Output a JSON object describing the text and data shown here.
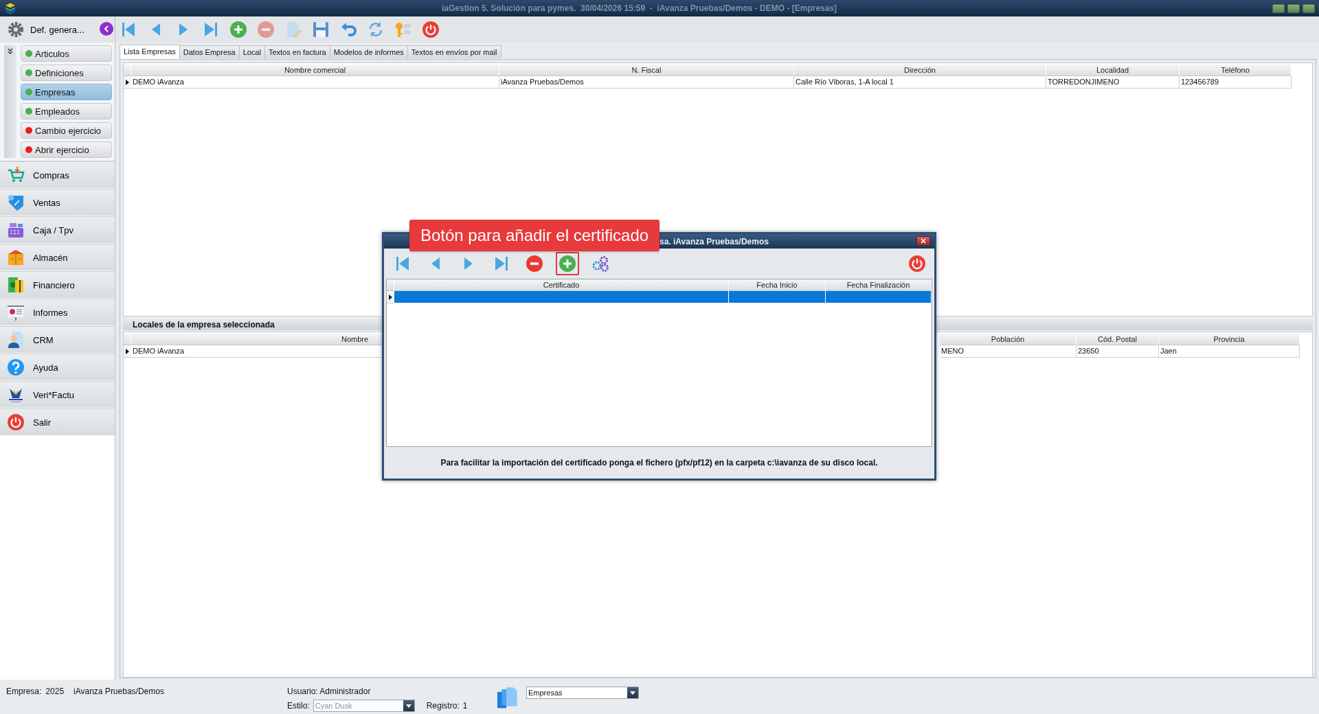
{
  "window": {
    "title": "iaGestion 5. Solución para pymes.  30/04/2026 15:59  -  iAvanza Pruebas/Demos - DEMO - [Empresas]"
  },
  "toolbar": [
    {
      "kind": "first",
      "disabled": false
    },
    {
      "kind": "prev",
      "disabled": false
    },
    {
      "kind": "next",
      "disabled": false
    },
    {
      "kind": "last",
      "disabled": false
    },
    {
      "kind": "add",
      "disabled": false
    },
    {
      "kind": "remove",
      "disabled": true
    },
    {
      "kind": "edit",
      "disabled": true
    },
    {
      "kind": "save",
      "disabled": false
    },
    {
      "kind": "undo",
      "disabled": false
    },
    {
      "kind": "refresh",
      "disabled": false
    },
    {
      "kind": "key",
      "disabled": false
    },
    {
      "kind": "power",
      "disabled": false
    }
  ],
  "sidebar": {
    "header": "Def. genera...",
    "sub_items": [
      {
        "label": "Articulos",
        "color": "#4caf50",
        "selected": false
      },
      {
        "label": "Definiciones",
        "color": "#4caf50",
        "selected": false
      },
      {
        "label": "Empresas",
        "color": "#4caf50",
        "selected": true
      },
      {
        "label": "Empleados",
        "color": "#4caf50",
        "selected": false
      },
      {
        "label": "Cambio ejercicio",
        "color": "#ee1c25",
        "selected": false
      },
      {
        "label": "Abrir ejercicio",
        "color": "#ee1c25",
        "selected": false
      }
    ],
    "modules": [
      {
        "label": "Compras",
        "kind": "cart"
      },
      {
        "label": "Ventas",
        "kind": "tag"
      },
      {
        "label": "Caja / Tpv",
        "kind": "register"
      },
      {
        "label": "Almacén",
        "kind": "boxes"
      },
      {
        "label": "Financiero",
        "kind": "money"
      },
      {
        "label": "Informes",
        "kind": "report"
      },
      {
        "label": "CRM",
        "kind": "person"
      },
      {
        "label": "Ayuda",
        "kind": "help"
      },
      {
        "label": "Veri*Factu",
        "kind": "agency"
      },
      {
        "label": "Salir",
        "kind": "power"
      }
    ]
  },
  "tabs": [
    {
      "label": "Lista Empresas",
      "selected": true
    },
    {
      "label": "Datos Empresa",
      "selected": false
    },
    {
      "label": "Local",
      "selected": false
    },
    {
      "label": "Textos en factura",
      "selected": false
    },
    {
      "label": "Modelos de informes",
      "selected": false
    },
    {
      "label": "Textos en envíos por mail",
      "selected": false
    }
  ],
  "companies_table": {
    "columns": [
      "Nombre comercial",
      "N. Fiscal",
      "Dirección",
      "Localidad",
      "Teléfono"
    ],
    "rows": [
      {
        "cells": [
          "DEMO iAvanza",
          "iAvanza Pruebas/Demos",
          "Calle Río Viboras, 1-A local 1",
          "TORREDONJIMENO",
          "123456789"
        ],
        "selected": true
      }
    ]
  },
  "locales_panel": {
    "title": "Locales de la empresa seleccionada",
    "columns": [
      "Nombre",
      "Población",
      "Cód. Postal",
      "Provincia"
    ],
    "rows": [
      {
        "cells": [
          "DEMO iAvanza",
          "MENO",
          "23650",
          "Jaen"
        ],
        "selected": true
      }
    ]
  },
  "dialog": {
    "title": "sa. iAvanza Pruebas/Demos",
    "toolbar": [
      {
        "kind": "first",
        "highlighted": false
      },
      {
        "kind": "prev",
        "highlighted": false
      },
      {
        "kind": "next",
        "highlighted": false
      },
      {
        "kind": "last",
        "highlighted": false
      },
      {
        "kind": "remove",
        "highlighted": false
      },
      {
        "kind": "add",
        "highlighted": true
      },
      {
        "kind": "settings",
        "highlighted": false
      },
      {
        "kind": "power",
        "highlighted": false
      }
    ],
    "columns": [
      "Certificado",
      "Fecha Inicio",
      "Fecha Finalización"
    ],
    "rows": [
      {
        "selected": true
      }
    ],
    "note": "Para facilitar la importación del certificado ponga el fichero (pfx/pf12) en la carpeta c:\\iavanza de su disco local."
  },
  "callout": {
    "text": "Botón para añadir el certificado"
  },
  "status_bar": {
    "company_label": "Empresa:",
    "year": "2025",
    "company": "iAvanza Pruebas/Demos",
    "user": "Usuario: Administrador",
    "style_label": "Estilo:",
    "style": {
      "value": "Cyan Dusk",
      "disabled": true
    },
    "record_label": "Registro:",
    "record": "1",
    "view": {
      "value": "Empresas",
      "disabled": false
    }
  }
}
